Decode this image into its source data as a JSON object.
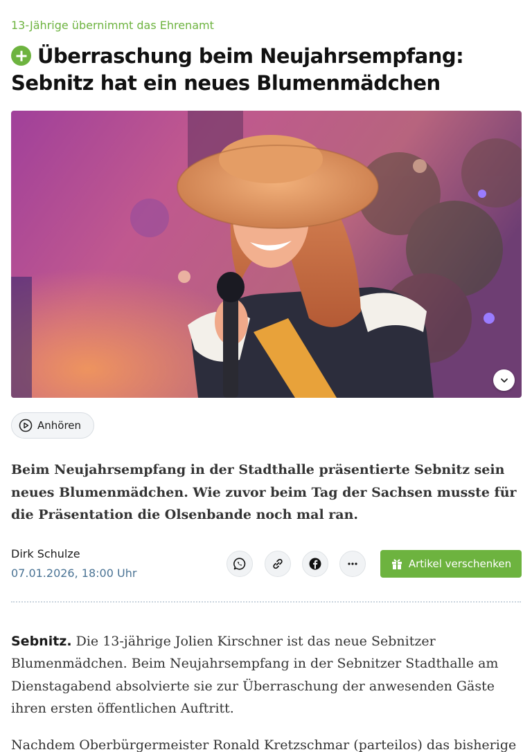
{
  "article": {
    "kicker": "13-Jährige übernimmt das Ehrenamt",
    "headline": "Überraschung beim Neujahrsempfang: Sebnitz hat ein neues Blumenmädchen",
    "listen_label": "Anhören",
    "lead": "Beim Neujahrsempfang in der Stadthalle präsentierte Sebnitz sein neues Blumenmädchen. Wie zuvor beim Tag der Sachsen musste für die Präsentation die Olsenbande noch mal ran.",
    "author": "Dirk Schulze",
    "date": "07.01.2026, 18:00 Uhr",
    "gift_label": "Artikel verschenken",
    "dateline": "Sebnitz.",
    "paragraph1": " Die 13-jährige Jolien Kirschner ist das neue Sebnitzer Blumenmädchen. Beim Neujahrsempfang in der Sebnitzer Stadthalle am Dienstagabend absolvierte sie zur Überraschung der anwesenden Gäste ihren ersten öffentlichen Auftritt.",
    "paragraph2": "Nachdem Oberbürgermeister Ronald Kretzschmar (parteilos) das bisherige"
  },
  "icons": {
    "plus": "plus-circle-icon",
    "play": "play-circle-icon",
    "expand": "chevron-down-icon",
    "share": [
      "whatsapp-icon",
      "link-icon",
      "facebook-icon",
      "more-icon"
    ],
    "gift": "gift-icon"
  },
  "colors": {
    "accent": "#6db33f",
    "date": "#4a7394",
    "divider": "#c9d4de"
  }
}
